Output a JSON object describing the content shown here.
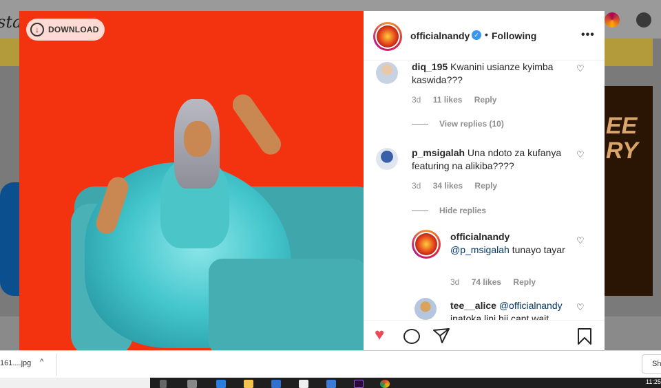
{
  "background": {
    "logo_text": "sta",
    "right_card_text": "EE\nRY"
  },
  "photo": {
    "download_label": "DOWNLOAD"
  },
  "header": {
    "username": "officialnandy",
    "verified_mark": "✓",
    "separator": "•",
    "follow_status": "Following",
    "more_label": "•••"
  },
  "comments": [
    {
      "username": "diq_195",
      "text": "Kwanini usianze kyimba kaswida???",
      "age": "3d",
      "likes": "11 likes",
      "reply": "Reply",
      "view_replies": "View replies (10)"
    },
    {
      "username": "p_msigalah",
      "text": "Una ndoto za kufanya featuring na alikiba????",
      "age": "3d",
      "likes": "34 likes",
      "reply": "Reply",
      "hide_replies": "Hide replies"
    },
    {
      "username": "officialnandy",
      "mention": "@p_msigalah",
      "text": "tunayo tayar",
      "age": "3d",
      "likes": "74 likes",
      "reply": "Reply"
    },
    {
      "username": "tee__alice",
      "mention": "@officialnandy",
      "text": "inatoka lini hii cant wait"
    }
  ],
  "icons": {
    "heart_outline": "♡",
    "like_filled": "♥",
    "comment": "◯",
    "share": "➤",
    "bookmark": "▭"
  },
  "download_bar": {
    "file_name": "161....jpg",
    "chevron": "^",
    "show_all": "Sh"
  },
  "taskbar": {
    "time": "11:25"
  },
  "colors": {
    "photo_bg": "#f3320f",
    "like_red": "#ed4956",
    "verified_blue": "#3897f0",
    "mention_blue": "#00376b"
  }
}
